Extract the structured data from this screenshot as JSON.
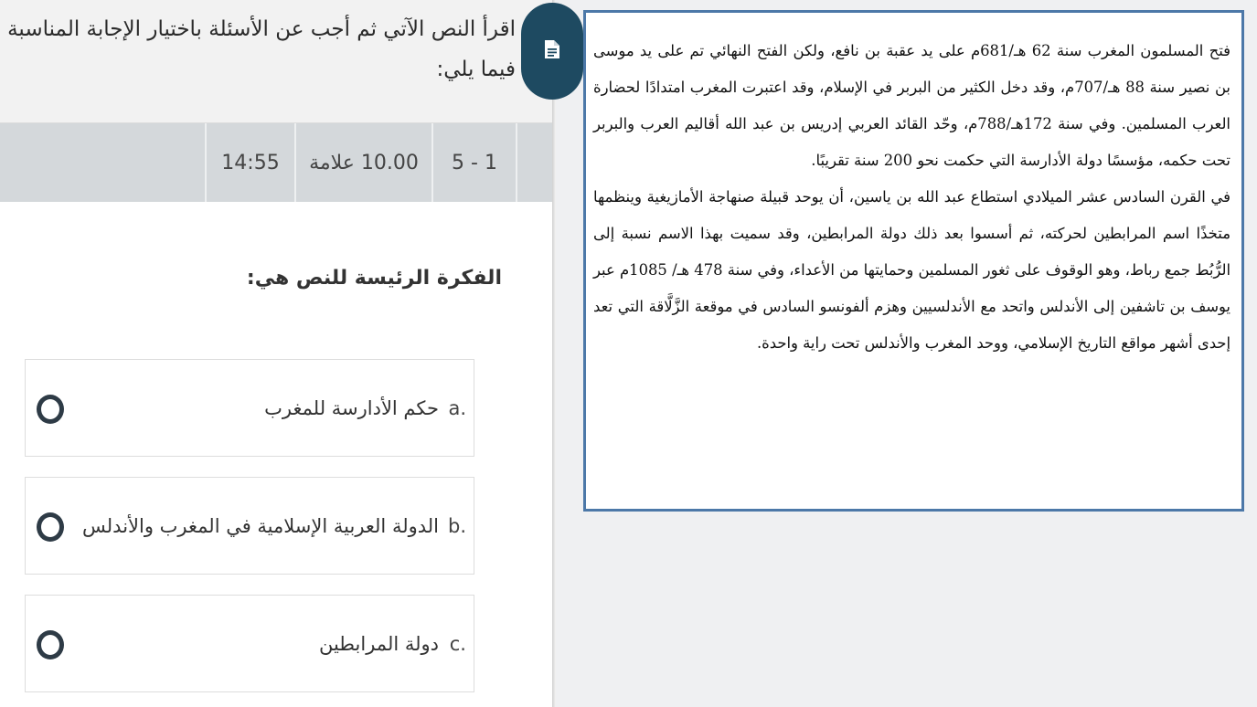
{
  "instruction": "اقرأ النص الآتي ثم أجب عن الأسئلة باختيار الإجابة المناسبة فيما يلي:",
  "info_bar": {
    "question_number": "1 - 5",
    "marks": "10.00 علامة",
    "timer": "14:55"
  },
  "question": {
    "title": "الفكرة الرئيسة للنص هي:",
    "options": [
      {
        "letter": "a.",
        "text": "حكم الأدارسة للمغرب"
      },
      {
        "letter": "b.",
        "text": "الدولة العربية الإسلامية في المغرب والأندلس"
      },
      {
        "letter": "c.",
        "text": "دولة المرابطين"
      }
    ]
  },
  "passage": {
    "paragraphs": [
      "فتح المسلمون المغرب سنة 62 هـ/681م على يد عقبة بن نافع، ولكن الفتح النهائي تم على يد موسى بن نصير سنة 88 هـ/707م، وقد دخل الكثير من البربر في الإسلام، وقد اعتبرت المغرب امتدادًا لحضارة العرب المسلمين. وفي سنة 172هـ/788م، وحّد القائد العربي إدريس بن عبد الله أقاليم العرب والبربر تحت حكمه، مؤسسًا دولة الأدارسة التي حكمت نحو 200 سنة تقريبًا.",
      "في القرن السادس عشر الميلادي استطاع عبد الله بن ياسين، أن يوحد قبيلة صنهاجة الأمازيغية وينظمها متخذًا اسم المرابطين لحركته، ثم أسسوا بعد ذلك دولة المرابطين، وقد سميت بهذا الاسم نسبة إلى الرُّبُط جمع رباط، وهو الوقوف على ثغور المسلمين وحمايتها من الأعداء، وفي سنة 478 هـ/ 1085م عبر يوسف بن تاشفين إلى الأندلس واتحد مع الأندلسيين وهزم ألفونسو السادس في موقعة الزَّلَّاقة التي تعد إحدى أشهر مواقع التاريخ الإسلامي، ووحد المغرب والأندلس تحت راية واحدة."
    ]
  },
  "icons": {
    "document": "document-icon",
    "radio": "radio-button-icon"
  },
  "colors": {
    "accent": "#1e4a61",
    "passage_border": "#4c78a8",
    "info_bar": "#d4d8db"
  }
}
